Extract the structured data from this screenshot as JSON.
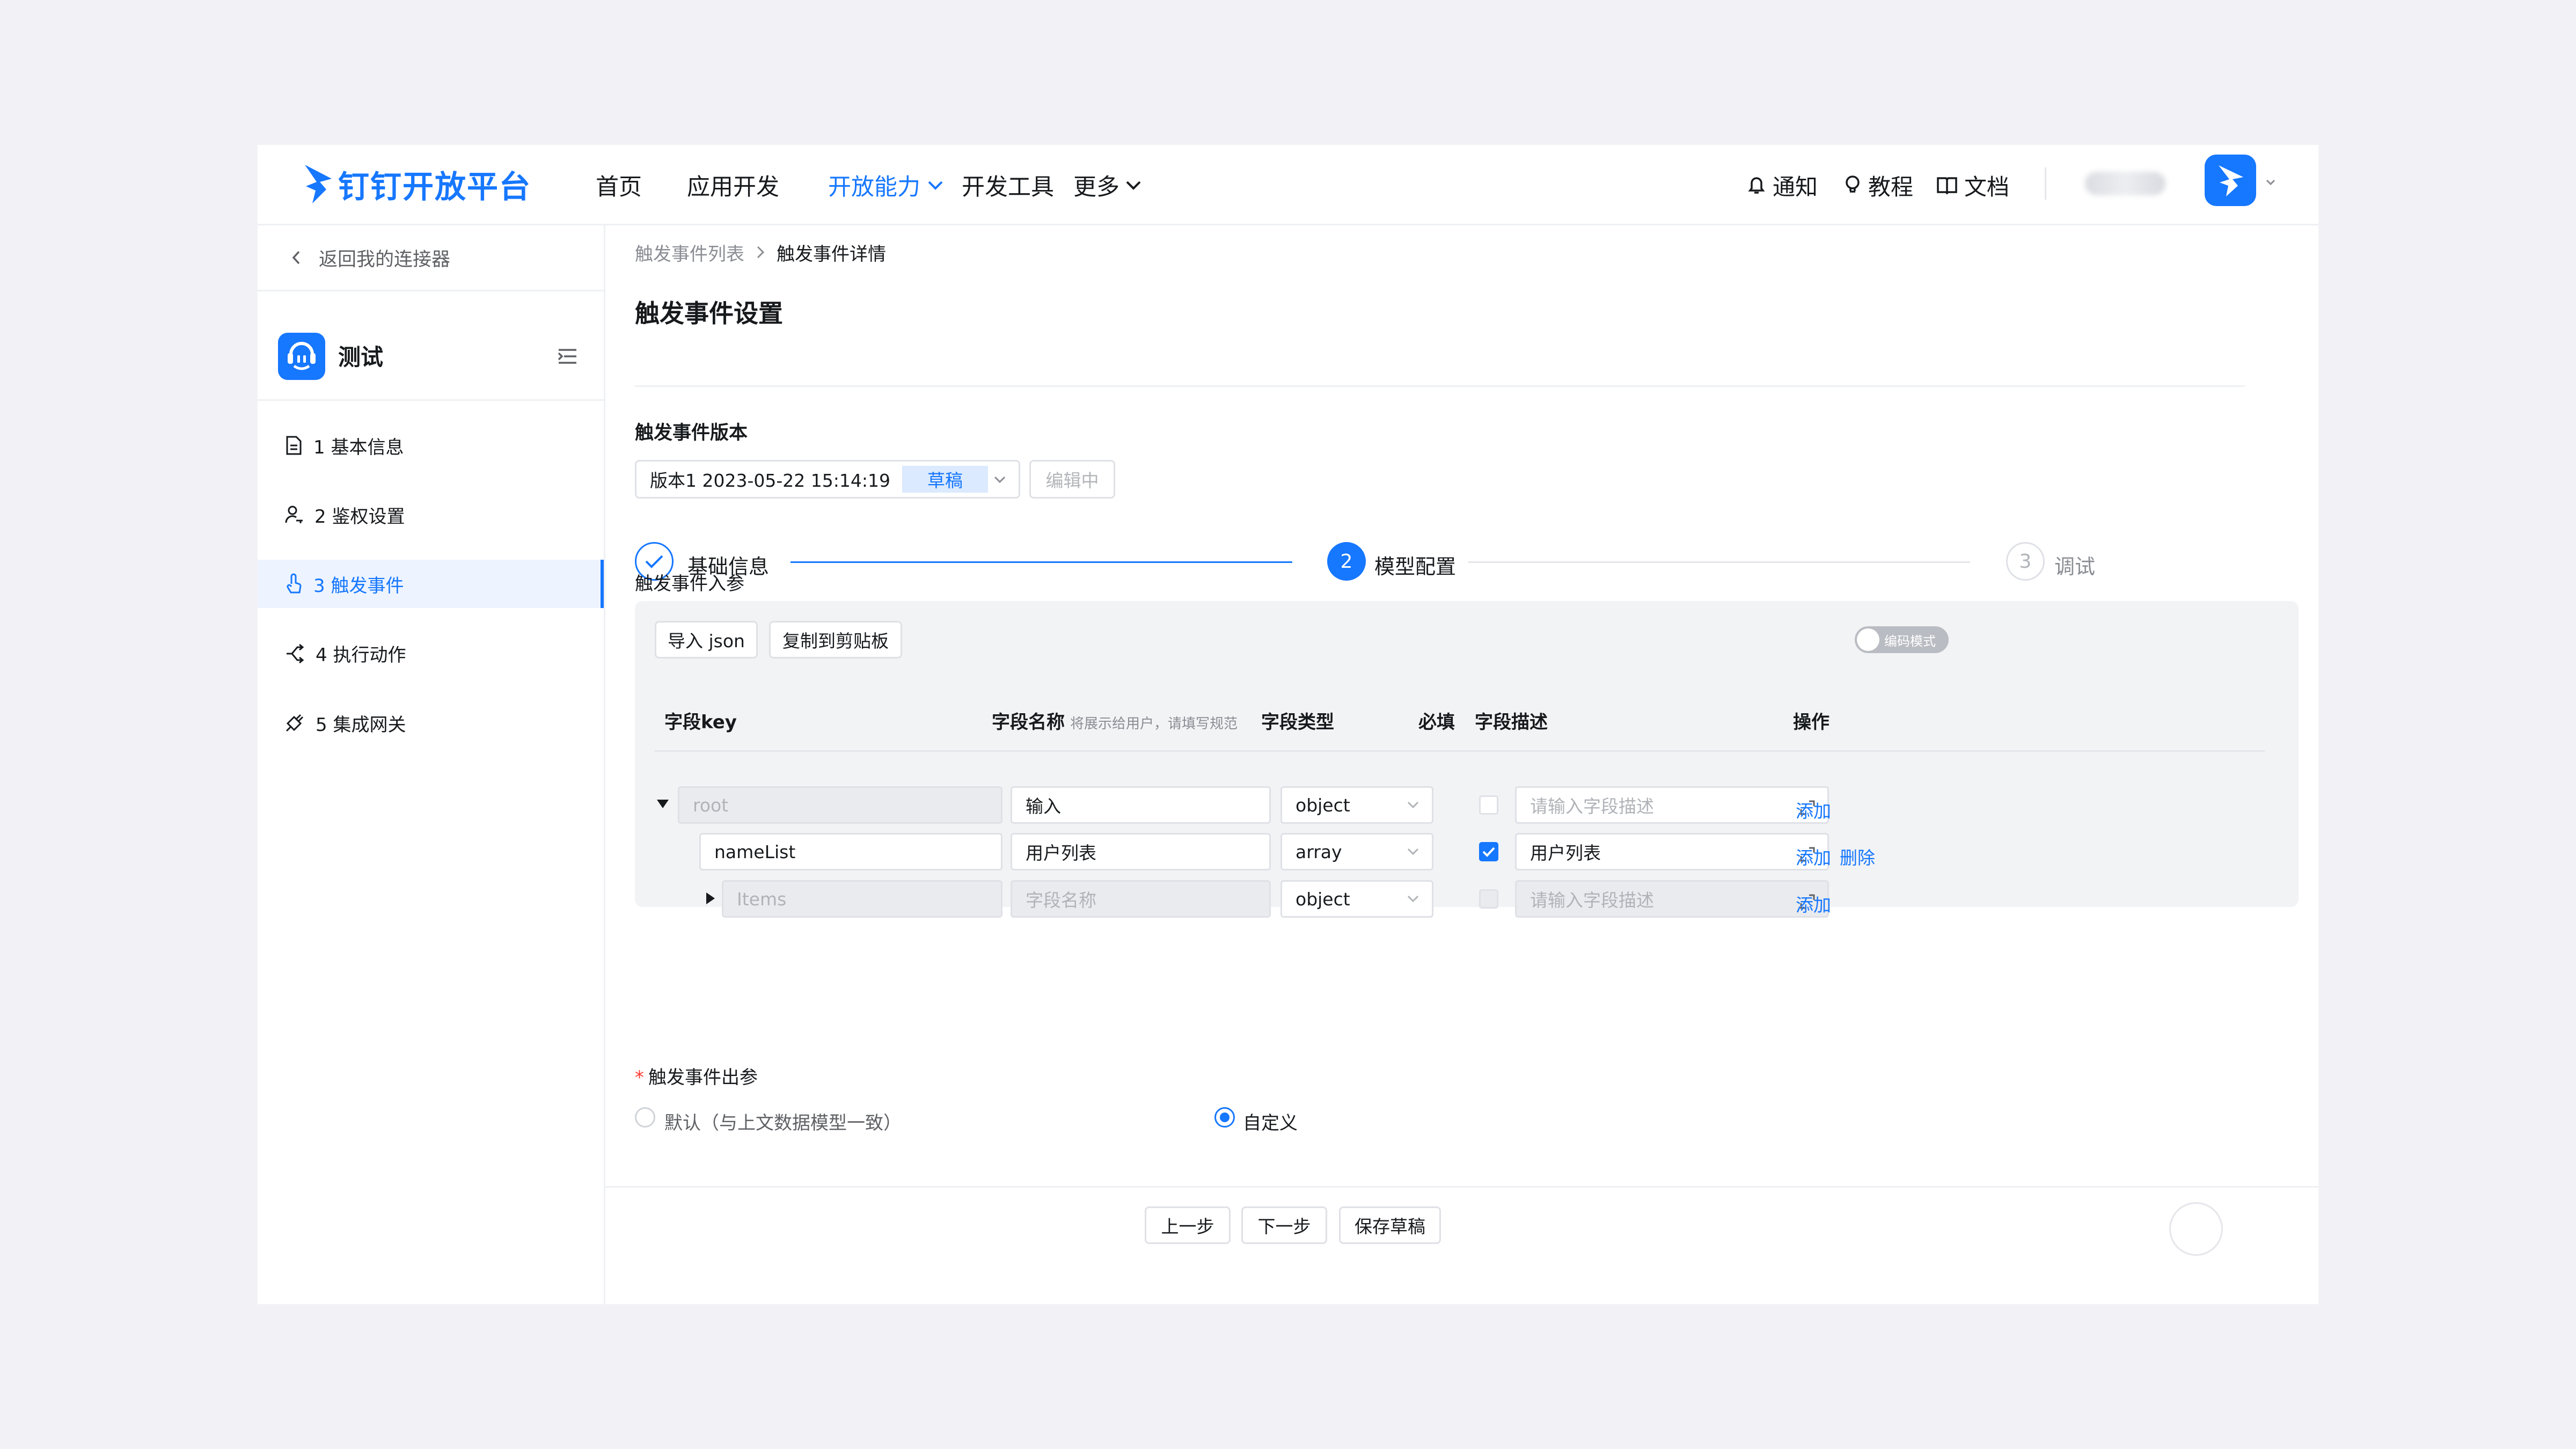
{
  "brand": {
    "name": "钉钉开放平台",
    "accent": "#1677ff"
  },
  "nav": {
    "items": [
      "首页",
      "应用开发",
      "开放能力",
      "开发工具",
      "更多"
    ],
    "right": {
      "notify": "通知",
      "tutorial": "教程",
      "docs": "文档"
    }
  },
  "sidebar": {
    "back": "返回我的连接器",
    "app_name": "测试",
    "items": [
      {
        "label": "1 基本信息",
        "icon": "document-icon"
      },
      {
        "label": "2 鉴权设置",
        "icon": "user-key-icon"
      },
      {
        "label": "3 触发事件",
        "icon": "pointer-icon",
        "active": true
      },
      {
        "label": "4 执行动作",
        "icon": "share-icon"
      },
      {
        "label": "5 集成网关",
        "icon": "plug-icon"
      }
    ]
  },
  "breadcrumb": {
    "parent": "触发事件列表",
    "current": "触发事件详情"
  },
  "page": {
    "title": "触发事件设置"
  },
  "version": {
    "heading": "触发事件版本",
    "value": "版本1 2023-05-22 15:14:19",
    "tag": "草稿",
    "status": "编辑中"
  },
  "steps": [
    {
      "num": "",
      "label": "基础信息",
      "state": "done"
    },
    {
      "num": "2",
      "label": "模型配置",
      "state": "current"
    },
    {
      "num": "3",
      "label": "调试",
      "state": "pending"
    }
  ],
  "input_params": {
    "heading": "触发事件入参",
    "import_button": "导入 json",
    "copy_button": "复制到剪贴板",
    "code_mode": "编码模式",
    "columns": {
      "key": "字段key",
      "name": "字段名称",
      "name_hint": "将展示给用户，请填写规范",
      "type": "字段类型",
      "required": "必填",
      "desc": "字段描述",
      "action": "操作"
    },
    "rows": [
      {
        "key": "root",
        "name": "输入",
        "type": "object",
        "required": false,
        "desc_placeholder": "请输入字段描述",
        "add": "添加"
      },
      {
        "key": "nameList",
        "name": "用户列表",
        "type": "array",
        "required": true,
        "desc": "用户列表",
        "add": "添加",
        "delete": "删除"
      },
      {
        "key": "Items",
        "name_placeholder": "字段名称",
        "type": "object",
        "required": false,
        "desc_placeholder": "请输入字段描述",
        "add": "添加"
      }
    ]
  },
  "output_params": {
    "heading": "触发事件出参",
    "option_default": "默认（与上文数据模型一致）",
    "option_custom": "自定义",
    "selected": "自定义"
  },
  "footer": {
    "prev": "上一步",
    "next": "下一步",
    "save": "保存草稿"
  }
}
